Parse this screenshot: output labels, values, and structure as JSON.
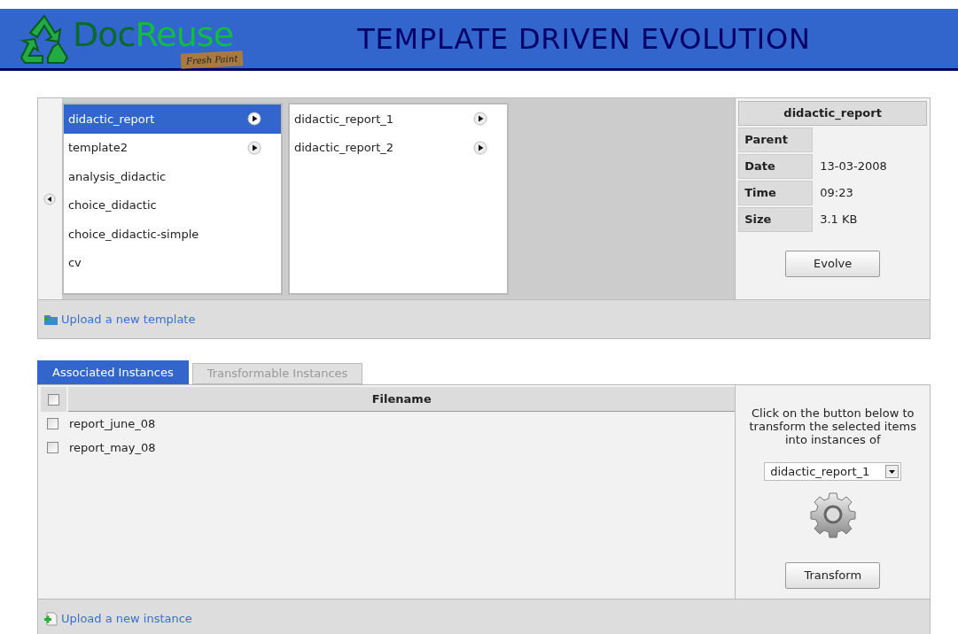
{
  "header": {
    "logo_part_1": "Doc",
    "logo_part_2": "Reuse",
    "logo_badge": "Fresh Paint",
    "title": "TEMPLATE DRIVEN EVOLUTION"
  },
  "browser": {
    "columns": [
      {
        "items": [
          {
            "label": "didactic_report",
            "selected": true,
            "has_children": true
          },
          {
            "label": "template2",
            "selected": false,
            "has_children": true
          },
          {
            "label": "analysis_didactic",
            "selected": false,
            "has_children": false
          },
          {
            "label": "choice_didactic",
            "selected": false,
            "has_children": false
          },
          {
            "label": "choice_didactic-simple",
            "selected": false,
            "has_children": false
          },
          {
            "label": "cv",
            "selected": false,
            "has_children": false
          }
        ]
      },
      {
        "items": [
          {
            "label": "didactic_report_1",
            "selected": false,
            "has_children": true
          },
          {
            "label": "didactic_report_2",
            "selected": false,
            "has_children": true
          }
        ]
      }
    ],
    "upload_link": "Upload a new template"
  },
  "details": {
    "title": "didactic_report",
    "fields": [
      {
        "label": "Parent"
      },
      {
        "label": "Date",
        "value": "13-03-2008"
      },
      {
        "label": "Time",
        "value": "09:23"
      },
      {
        "label": "Size",
        "value": "3.1 KB"
      }
    ],
    "button": "Evolve"
  },
  "tabs": [
    {
      "label": "Associated Instances",
      "selected": true
    },
    {
      "label": "Transformable Instances",
      "selected": false
    }
  ],
  "table": {
    "columns": [
      "Filename"
    ],
    "select_all_checked": false,
    "rows": [
      {
        "filename": "report_june_08",
        "checked": false
      },
      {
        "filename": "report_may_08",
        "checked": false
      }
    ],
    "upload_link": "Upload a new instance"
  },
  "transform": {
    "instruction": "Click on the button below to transform the selected items into instances of",
    "select_value": "didactic_report_1",
    "button": "Transform"
  }
}
